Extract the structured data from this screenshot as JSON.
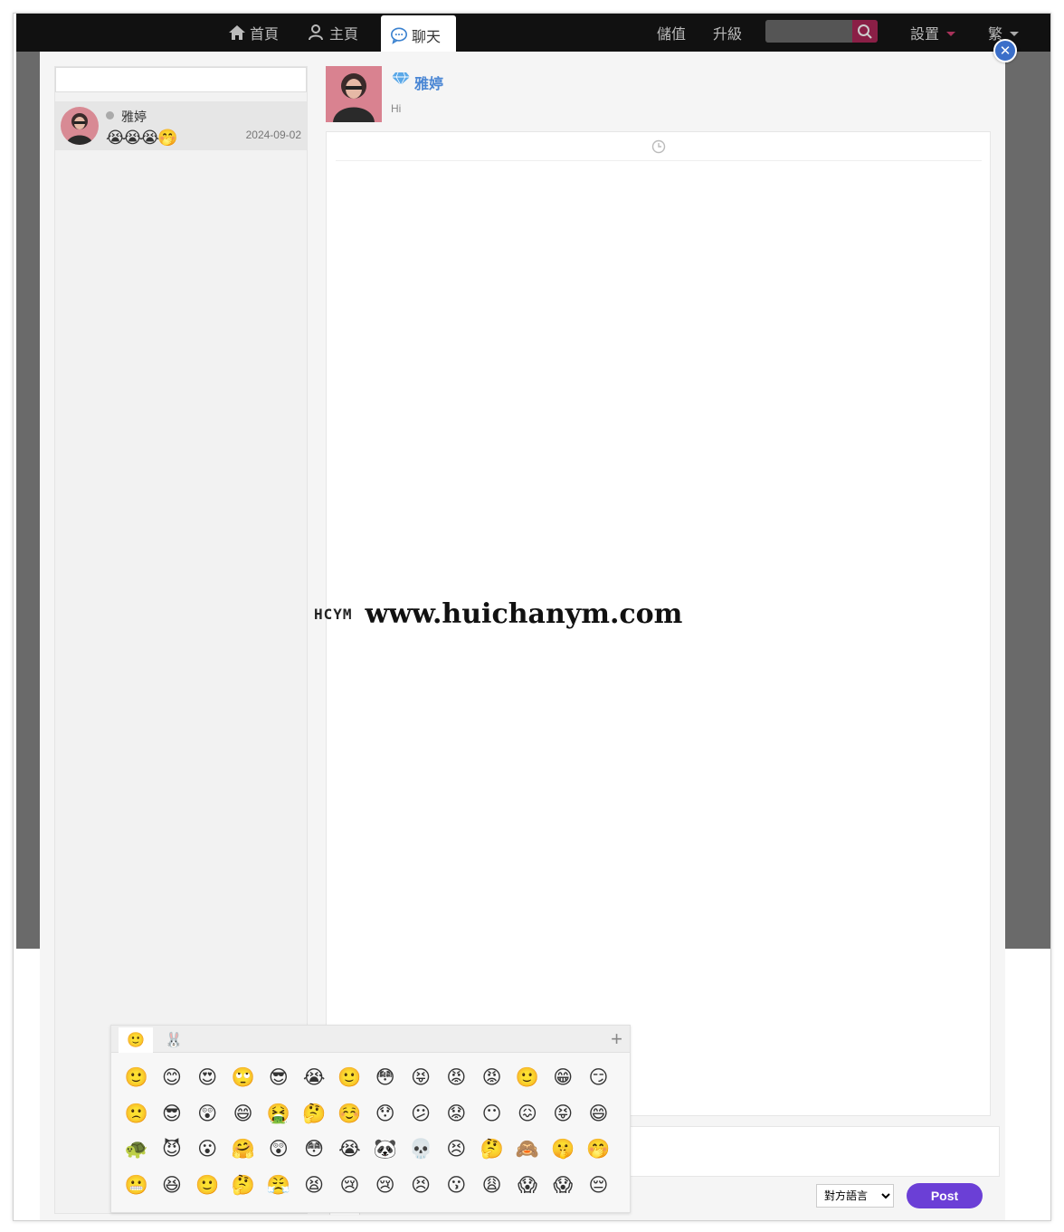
{
  "nav": {
    "home": "首頁",
    "main": "主頁",
    "chat": "聊天",
    "recharge": "儲值",
    "upgrade": "升級",
    "settings": "設置",
    "language": "繁"
  },
  "conversations": [
    {
      "name": "雅婷",
      "preview": "😭😭😭🤭",
      "date": "2024-09-02",
      "status": "offline"
    }
  ],
  "chat": {
    "contact_name": "雅婷",
    "contact_subtitle": "Hi"
  },
  "composer": {
    "language_option": "對方語言",
    "post_label": "Post"
  },
  "emoji_panel": {
    "tabs": [
      "🙂",
      "🐰"
    ],
    "add_label": "+",
    "emojis": [
      "🙂",
      "😊",
      "😍",
      "🙄",
      "😎",
      "😭",
      "🙂",
      "😳",
      "😝",
      "😡",
      "😡",
      "🙂",
      "😁",
      "😏",
      "🙁",
      "😎",
      "😲",
      "😄",
      "🤮",
      "🤔",
      "☺️",
      "😯",
      "😕",
      "😟",
      "😶",
      "😖",
      "😝",
      "😄",
      "🐢",
      "😈",
      "😮",
      "🤗",
      "😲",
      "😳",
      "😭",
      "🐼",
      "💀",
      "😣",
      "🤔",
      "🙈",
      "🤫",
      "🤭",
      "😬",
      "😆",
      "🙂",
      "🤔",
      "😤",
      "😫",
      "😢",
      "😢",
      "😣",
      "😗",
      "😩",
      "😱",
      "😱",
      "😔"
    ]
  },
  "watermark": {
    "logo": "HCYM",
    "url": "www.huichanym.com"
  },
  "colors": {
    "accent_blue": "#4a86d4",
    "post_purple": "#6b3fd6",
    "topbar": "#111111",
    "overlay": "#6a6a6a"
  }
}
